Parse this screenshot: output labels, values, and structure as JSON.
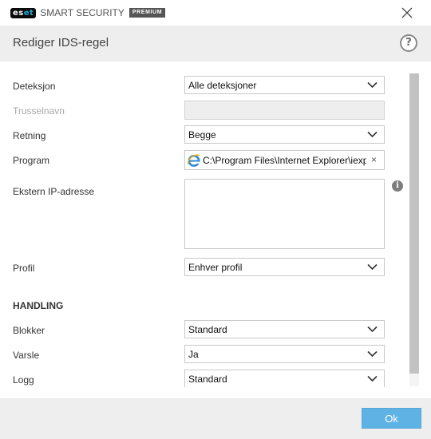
{
  "app": {
    "brand_short": "es",
    "brand_short_accent": "et",
    "product_name": "SMART SECURITY",
    "tier": "PREMIUM"
  },
  "dialog": {
    "title": "Rediger IDS-regel",
    "help_symbol": "?"
  },
  "form": {
    "detection": {
      "label": "Deteksjon",
      "value": "Alle deteksjoner"
    },
    "threat_name": {
      "label": "Trusselnavn",
      "value": ""
    },
    "direction": {
      "label": "Retning",
      "value": "Begge"
    },
    "program": {
      "label": "Program",
      "value": "C:\\Program Files\\Internet Explorer\\iexplore.exe",
      "icon": "internet-explorer-icon",
      "clear_symbol": "×"
    },
    "remote_ip": {
      "label": "Ekstern IP-adresse",
      "value": "",
      "info_symbol": "i"
    },
    "profile": {
      "label": "Profil",
      "value": "Enhver profil"
    }
  },
  "action_section": {
    "heading": "HANDLING",
    "block": {
      "label": "Blokker",
      "value": "Standard"
    },
    "notify": {
      "label": "Varsle",
      "value": "Ja"
    },
    "log": {
      "label": "Logg",
      "value": "Standard"
    }
  },
  "footer": {
    "ok_label": "Ok"
  },
  "colors": {
    "accent": "#5fb3e4",
    "header_bg": "#eeeeee",
    "brand_accent": "#18a9d8"
  }
}
